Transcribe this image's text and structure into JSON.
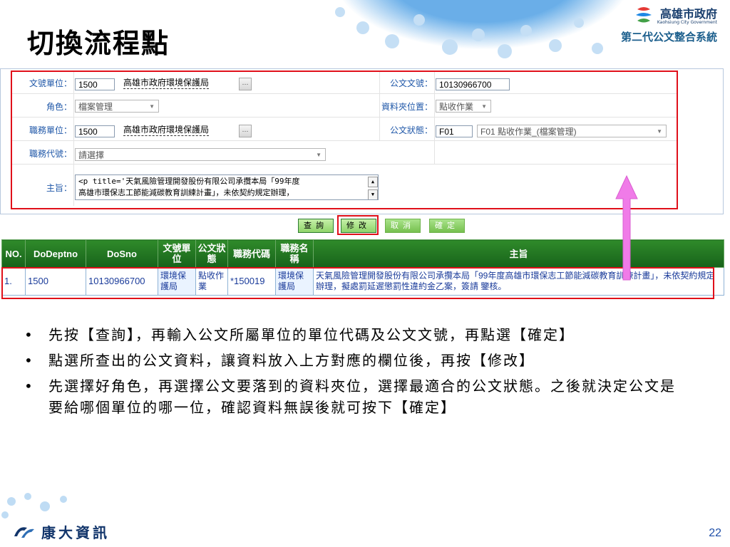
{
  "slide": {
    "title": "切換流程點",
    "page_number": "22"
  },
  "brand": {
    "name": "高雄市政府",
    "name_en": "Kaohsiung City Government",
    "system": "第二代公文整合系統",
    "footer_company": "康大資訊"
  },
  "form": {
    "doc_unit_label": "文號單位：",
    "doc_unit_code": "1500",
    "doc_unit_name": "高雄市政府環境保護局",
    "doc_no_label": "公文文號：",
    "doc_no_value": "10130966700",
    "role_label": "角色：",
    "role_value": "檔案管理",
    "folder_label": "資料夾位置：",
    "folder_value": "點收作業",
    "duty_unit_label": "職務單位：",
    "duty_unit_code": "1500",
    "duty_unit_name": "高雄市政府環境保護局",
    "status_label": "公文狀態：",
    "status_code": "F01",
    "status_value": "F01 點收作業_(檔案管理)",
    "duty_code_label": "職務代號：",
    "duty_code_placeholder": "請選擇",
    "subject_label": "主旨：",
    "subject_line1": "<p title='天氣風險管理開發股份有限公司承攬本局「99年度",
    "subject_line2": "高雄市環保志工節能減碳教育訓練計畫」，未依契約規定辦理，"
  },
  "actions": {
    "query": "查詢",
    "modify": "修改",
    "cancel": "取消",
    "confirm": "確定"
  },
  "grid": {
    "headers": [
      "NO.",
      "DoDeptno",
      "DoSno",
      "文號單位",
      "公文狀態",
      "職務代碼",
      "職務名稱",
      "主旨"
    ],
    "rows": [
      {
        "no": "1.",
        "dept": "1500",
        "sno": "10130966700",
        "unit": "環境保護局",
        "status": "點收作業",
        "duty_code": "*150019",
        "duty_name": "環境保護局",
        "subject": "天氣風險管理開發股份有限公司承攬本局「99年度高雄市環保志工節能減碳教育訓練計畫」，未依契約規定辦理，擬處罰延遲懲罰性違約金乙案，簽請 鑒核。"
      }
    ]
  },
  "bullets": [
    "先按【查詢】，再輸入公文所屬單位的單位代碼及公文文號，再點選【確定】",
    "點選所查出的公文資料，讓資料放入上方對應的欄位後，再按【修改】",
    "先選擇好角色，再選擇公文要落到的資料夾位，選擇最適合的公文狀態。之後就決定公文是要給哪個單位的哪一位，確認資料無誤後就可按下【確定】"
  ],
  "colors": {
    "highlight_red": "#e0101a",
    "grid_header": "#1f7a24",
    "label_blue": "#1f57a8",
    "arrow_pink": "#f07be8"
  }
}
